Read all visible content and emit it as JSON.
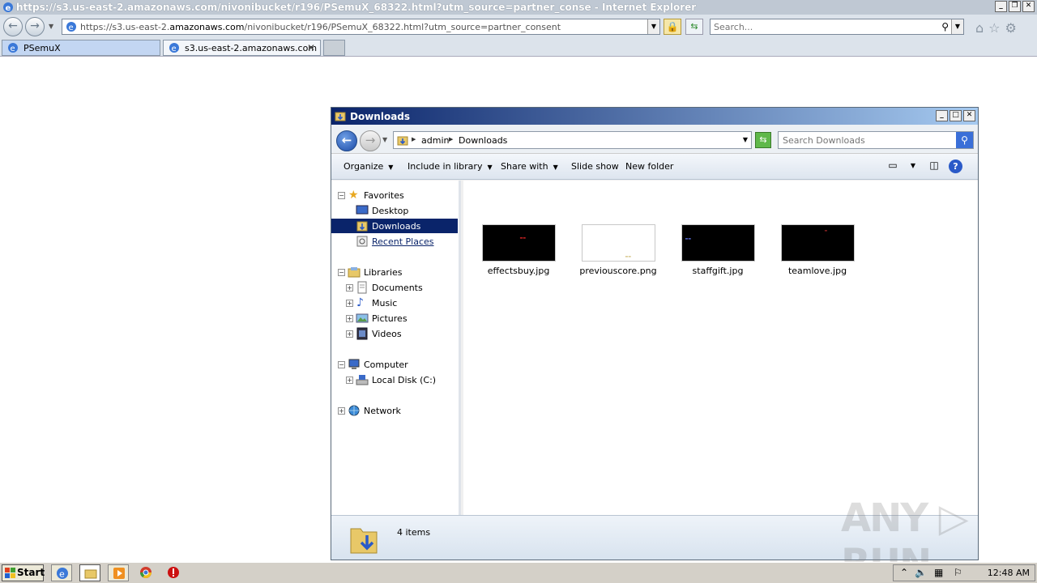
{
  "browser": {
    "window_title": "https://s3.us-east-2.amazonaws.com/nivonibucket/r196/PSemuX_68322.html?utm_source=partner_conse - Internet Explorer",
    "url_prefix": "https://s3.us-east-2.",
    "url_domain": "amazonaws.com",
    "url_rest": "/nivonibucket/r196/PSemuX_68322.html?utm_source=partner_consent",
    "search_placeholder": "Search...",
    "tabs": [
      {
        "label": "PSemuX"
      },
      {
        "label": "s3.us-east-2.amazonaws.com"
      }
    ]
  },
  "explorer": {
    "title": "Downloads",
    "breadcrumb": [
      "admin",
      "Downloads"
    ],
    "search_placeholder": "Search Downloads",
    "toolbar": {
      "organize": "Organize",
      "include_in_library": "Include in library",
      "share_with": "Share with",
      "slide_show": "Slide show",
      "new_folder": "New folder"
    },
    "nav": {
      "favorites": "Favorites",
      "desktop": "Desktop",
      "downloads": "Downloads",
      "recent_places": "Recent Places",
      "libraries": "Libraries",
      "documents": "Documents",
      "music": "Music",
      "pictures": "Pictures",
      "videos": "Videos",
      "computer": "Computer",
      "local_disk": "Local Disk (C:)",
      "network": "Network"
    },
    "files": [
      {
        "name": "effectsbuy.jpg",
        "thumb_bg": "#000000",
        "mark_color": "#cc2222"
      },
      {
        "name": "previouscore.png",
        "thumb_bg": "#ffffff",
        "mark_color": "#d8c890"
      },
      {
        "name": "staffgift.jpg",
        "thumb_bg": "#000000",
        "mark_color": "#5566cc"
      },
      {
        "name": "teamlove.jpg",
        "thumb_bg": "#000000",
        "mark_color": "#882222"
      }
    ],
    "status": "4 items"
  },
  "taskbar": {
    "start": "Start",
    "clock": "12:48 AM"
  },
  "watermark": "ANY RUN"
}
